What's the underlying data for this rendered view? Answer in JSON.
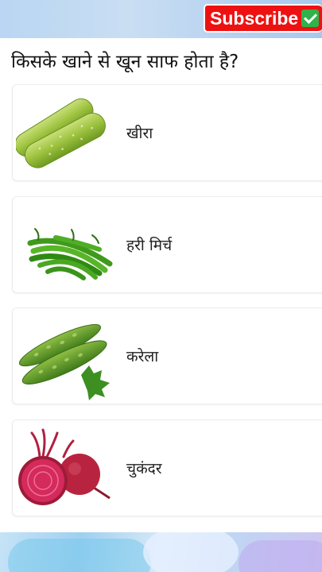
{
  "header": {
    "subscribe_label": "Subscribe",
    "subscribe_icon": "check-mark-icon",
    "subscribe_color": "#ee1111"
  },
  "question": "किसके खाने से खून साफ होता है?",
  "options": [
    {
      "label": "खीरा",
      "icon": "cucumber-image"
    },
    {
      "label": "हरी मिर्च",
      "icon": "green-chili-image"
    },
    {
      "label": "करेला",
      "icon": "bitter-gourd-image"
    },
    {
      "label": "चुकंदर",
      "icon": "beetroot-image"
    }
  ]
}
